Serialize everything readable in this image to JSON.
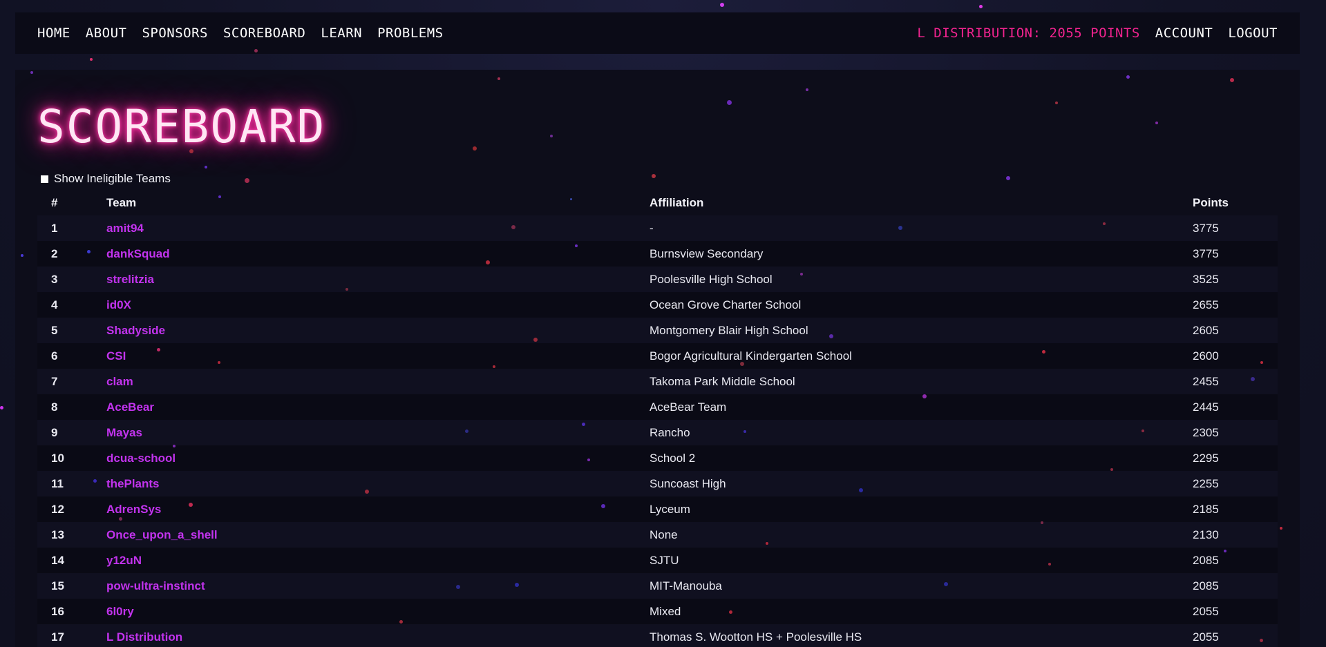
{
  "nav": {
    "left": [
      {
        "key": "home",
        "label": "HOME"
      },
      {
        "key": "about",
        "label": "ABOUT"
      },
      {
        "key": "sponsors",
        "label": "SPONSORS"
      },
      {
        "key": "scoreboard",
        "label": "SCOREBOARD"
      },
      {
        "key": "learn",
        "label": "LEARN"
      },
      {
        "key": "problems",
        "label": "PROBLEMS"
      }
    ],
    "team_points": "L DISTRIBUTION: 2055 POINTS",
    "account": "ACCOUNT",
    "logout": "LOGOUT"
  },
  "page": {
    "title": "SCOREBOARD",
    "toggle_label": "Show Ineligible Teams",
    "toggle_checked": false
  },
  "table": {
    "headers": {
      "rank": "#",
      "team": "Team",
      "affiliation": "Affiliation",
      "points": "Points"
    },
    "rows": [
      {
        "rank": "1",
        "team": "amit94",
        "affiliation": "-",
        "points": "3775"
      },
      {
        "rank": "2",
        "team": "dankSquad",
        "affiliation": "Burnsview Secondary",
        "points": "3775"
      },
      {
        "rank": "3",
        "team": "strelitzia",
        "affiliation": "Poolesville High School",
        "points": "3525"
      },
      {
        "rank": "4",
        "team": "id0X",
        "affiliation": "Ocean Grove Charter School",
        "points": "2655"
      },
      {
        "rank": "5",
        "team": "Shadyside",
        "affiliation": "Montgomery Blair High School",
        "points": "2605"
      },
      {
        "rank": "6",
        "team": "CSI",
        "affiliation": "Bogor Agricultural Kindergarten School",
        "points": "2600"
      },
      {
        "rank": "7",
        "team": "clam",
        "affiliation": "Takoma Park Middle School",
        "points": "2455"
      },
      {
        "rank": "8",
        "team": "AceBear",
        "affiliation": "AceBear Team",
        "points": "2445"
      },
      {
        "rank": "9",
        "team": "Mayas",
        "affiliation": "Rancho",
        "points": "2305"
      },
      {
        "rank": "10",
        "team": "dcua-school",
        "affiliation": "School 2",
        "points": "2295"
      },
      {
        "rank": "11",
        "team": "thePlants",
        "affiliation": "Suncoast High",
        "points": "2255"
      },
      {
        "rank": "12",
        "team": "AdrenSys",
        "affiliation": "Lyceum",
        "points": "2185"
      },
      {
        "rank": "13",
        "team": "Once_upon_a_shell",
        "affiliation": "None",
        "points": "2130"
      },
      {
        "rank": "14",
        "team": "y12uN",
        "affiliation": "SJTU",
        "points": "2085"
      },
      {
        "rank": "15",
        "team": "pow-ultra-instinct",
        "affiliation": "MIT-Manouba",
        "points": "2085"
      },
      {
        "rank": "16",
        "team": "6l0ry",
        "affiliation": "Mixed",
        "points": "2055"
      },
      {
        "rank": "17",
        "team": "L Distribution",
        "affiliation": "Thomas S. Wootton HS + Poolesville HS",
        "points": "2055"
      }
    ]
  },
  "colors": {
    "accent_pink": "#f2238f",
    "team_link": "#c233ee",
    "panel_bg": "#0d0d1a",
    "page_bg": "#14152a"
  }
}
